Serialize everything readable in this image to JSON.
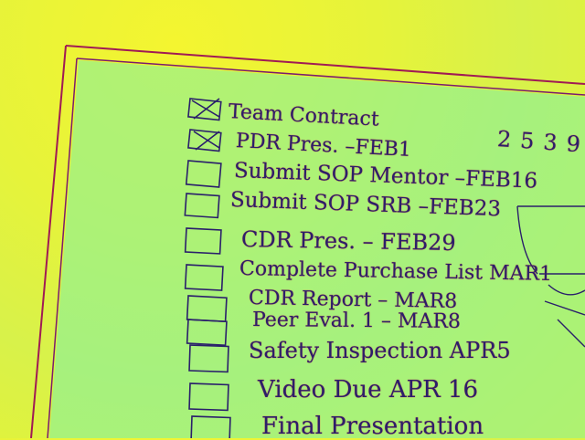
{
  "whiteboard": {
    "side_number": "2539",
    "items": [
      {
        "text": "Team Contract",
        "checked": true
      },
      {
        "text": "PDR Pres. –FEB1",
        "checked": true
      },
      {
        "text": "Submit SOP Mentor –FEB16",
        "checked": false
      },
      {
        "text": "Submit SOP SRB –FEB23",
        "checked": false
      },
      {
        "text": "CDR Pres. – FEB29",
        "checked": false
      },
      {
        "text": "Complete Purchase List MAR1",
        "checked": false
      },
      {
        "text": "CDR Report – MAR8",
        "checked": false
      },
      {
        "text": "Peer Eval. 1 – MAR8",
        "checked": false
      },
      {
        "text": "Safety Inspection APR5",
        "checked": false
      },
      {
        "text": "Video Due APR 16",
        "checked": false
      },
      {
        "text": "Final Presentation",
        "checked": false
      }
    ]
  }
}
